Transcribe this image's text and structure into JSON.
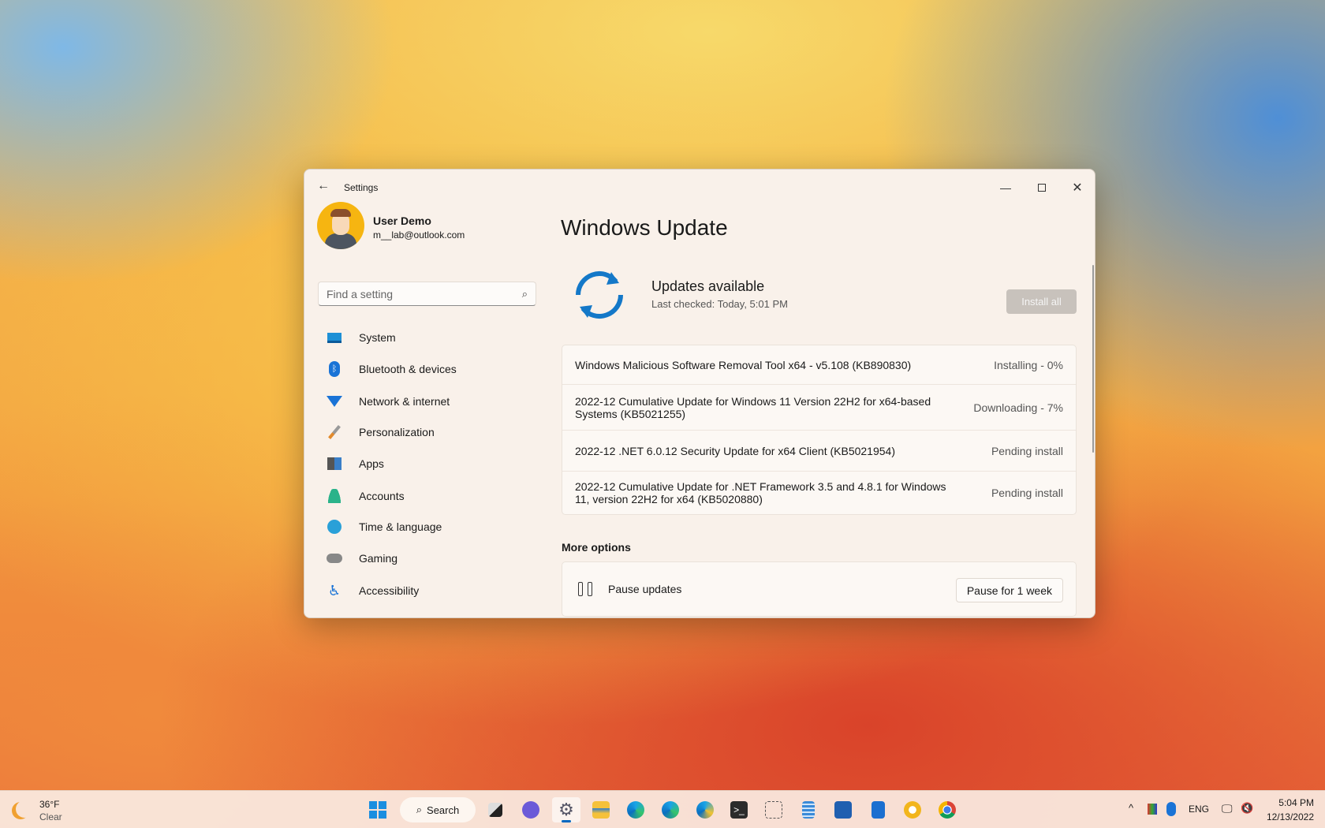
{
  "window": {
    "title": "Settings"
  },
  "user": {
    "name": "User Demo",
    "email": "m__lab@outlook.com"
  },
  "search": {
    "placeholder": "Find a setting"
  },
  "nav": [
    {
      "label": "System",
      "icon": "system-icon"
    },
    {
      "label": "Bluetooth & devices",
      "icon": "bluetooth-icon"
    },
    {
      "label": "Network & internet",
      "icon": "wifi-icon"
    },
    {
      "label": "Personalization",
      "icon": "brush-icon"
    },
    {
      "label": "Apps",
      "icon": "apps-icon"
    },
    {
      "label": "Accounts",
      "icon": "person-icon"
    },
    {
      "label": "Time & language",
      "icon": "globe-clock-icon"
    },
    {
      "label": "Gaming",
      "icon": "gamepad-icon"
    },
    {
      "label": "Accessibility",
      "icon": "accessibility-icon"
    }
  ],
  "main": {
    "title": "Windows Update",
    "status": "Updates available",
    "last_checked": "Last checked: Today, 5:01 PM",
    "install_all": "Install all",
    "updates": [
      {
        "name": "Windows Malicious Software Removal Tool x64 - v5.108 (KB890830)",
        "status": "Installing - 0%"
      },
      {
        "name": "2022-12 Cumulative Update for Windows 11 Version 22H2 for x64-based Systems (KB5021255)",
        "status": "Downloading - 7%"
      },
      {
        "name": "2022-12 .NET 6.0.12 Security Update for x64 Client (KB5021954)",
        "status": "Pending install"
      },
      {
        "name": "2022-12 Cumulative Update for .NET Framework 3.5 and 4.8.1 for Windows 11, version 22H2 for x64 (KB5020880)",
        "status": "Pending install"
      }
    ],
    "more_options": "More options",
    "pause_label": "Pause updates",
    "pause_button": "Pause for 1 week"
  },
  "taskbar": {
    "weather_temp": "36°F",
    "weather_desc": "Clear",
    "search": "Search",
    "lang": "ENG",
    "time": "5:04 PM",
    "date": "12/13/2022"
  },
  "colors": {
    "accent": "#0067c0",
    "window_bg": "#f9f1ea"
  }
}
